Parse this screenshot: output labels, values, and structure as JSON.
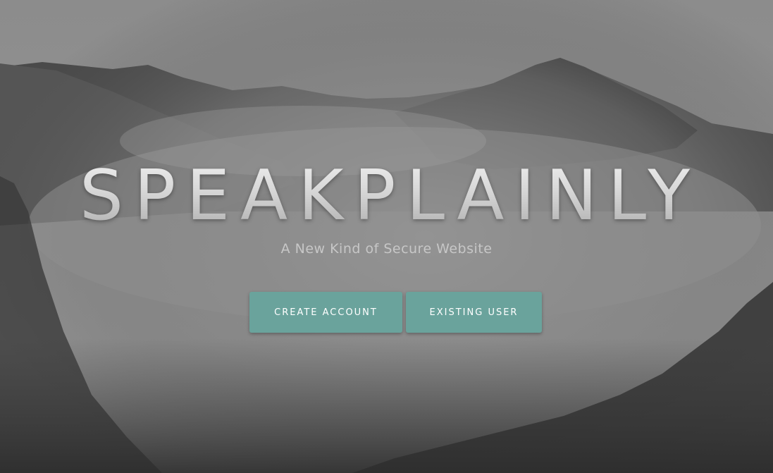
{
  "hero": {
    "title": "SPEAKPLAINLY",
    "tagline": "A New Kind of Secure Website"
  },
  "actions": {
    "create_label": "CREATE ACCOUNT",
    "existing_label": "EXISTING USER"
  },
  "colors": {
    "button": "#6aa39c",
    "button_text": "#ffffff",
    "tagline": "#c7c7c7"
  }
}
